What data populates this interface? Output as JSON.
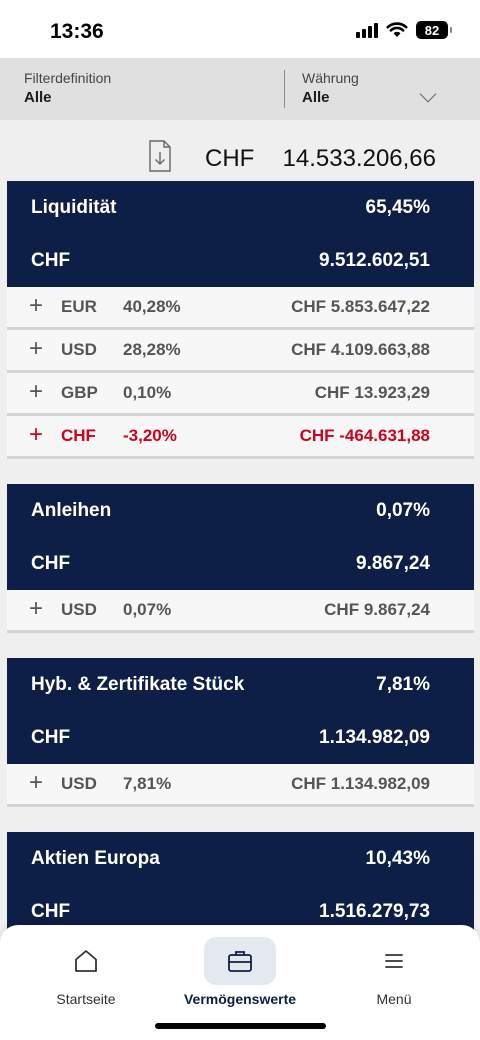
{
  "status_bar": {
    "time": "13:36",
    "battery": "82",
    "icons": [
      "cellular-signal-icon",
      "wifi-icon",
      "battery-icon"
    ]
  },
  "filters": {
    "filter_label": "Filterdefinition",
    "filter_value": "Alle",
    "currency_label": "Währung",
    "currency_value": "Alle"
  },
  "total": {
    "currency": "CHF",
    "amount": "14.533.206,66",
    "icon": "download-document-icon"
  },
  "sections": [
    {
      "title": "Liquidität",
      "percent": "65,45%",
      "currency": "CHF",
      "value": "9.512.602,51",
      "rows": [
        {
          "currency": "EUR",
          "percent": "40,28%",
          "amount": "CHF 5.853.647,22",
          "negative": false
        },
        {
          "currency": "USD",
          "percent": "28,28%",
          "amount": "CHF 4.109.663,88",
          "negative": false
        },
        {
          "currency": "GBP",
          "percent": "0,10%",
          "amount": "CHF 13.923,29",
          "negative": false
        },
        {
          "currency": "CHF",
          "percent": "-3,20%",
          "amount": "CHF -464.631,88",
          "negative": true
        }
      ]
    },
    {
      "title": "Anleihen",
      "percent": "0,07%",
      "currency": "CHF",
      "value": "9.867,24",
      "rows": [
        {
          "currency": "USD",
          "percent": "0,07%",
          "amount": "CHF 9.867,24",
          "negative": false
        }
      ]
    },
    {
      "title": "Hyb. & Zertifikate Stück",
      "percent": "7,81%",
      "currency": "CHF",
      "value": "1.134.982,09",
      "rows": [
        {
          "currency": "USD",
          "percent": "7,81%",
          "amount": "CHF 1.134.982,09",
          "negative": false
        }
      ]
    },
    {
      "title": "Aktien Europa",
      "percent": "10,43%",
      "currency": "CHF",
      "value": "1.516.279,73",
      "rows": []
    }
  ],
  "nav": {
    "items": [
      {
        "label": "Startseite",
        "icon": "home-icon",
        "active": false
      },
      {
        "label": "Vermögenswerte",
        "icon": "briefcase-icon",
        "active": true
      },
      {
        "label": "Menü",
        "icon": "menu-icon",
        "active": false
      }
    ]
  },
  "colors": {
    "header_navy": "#0e1f47",
    "negative_red": "#d0021b",
    "background": "#efefef"
  }
}
